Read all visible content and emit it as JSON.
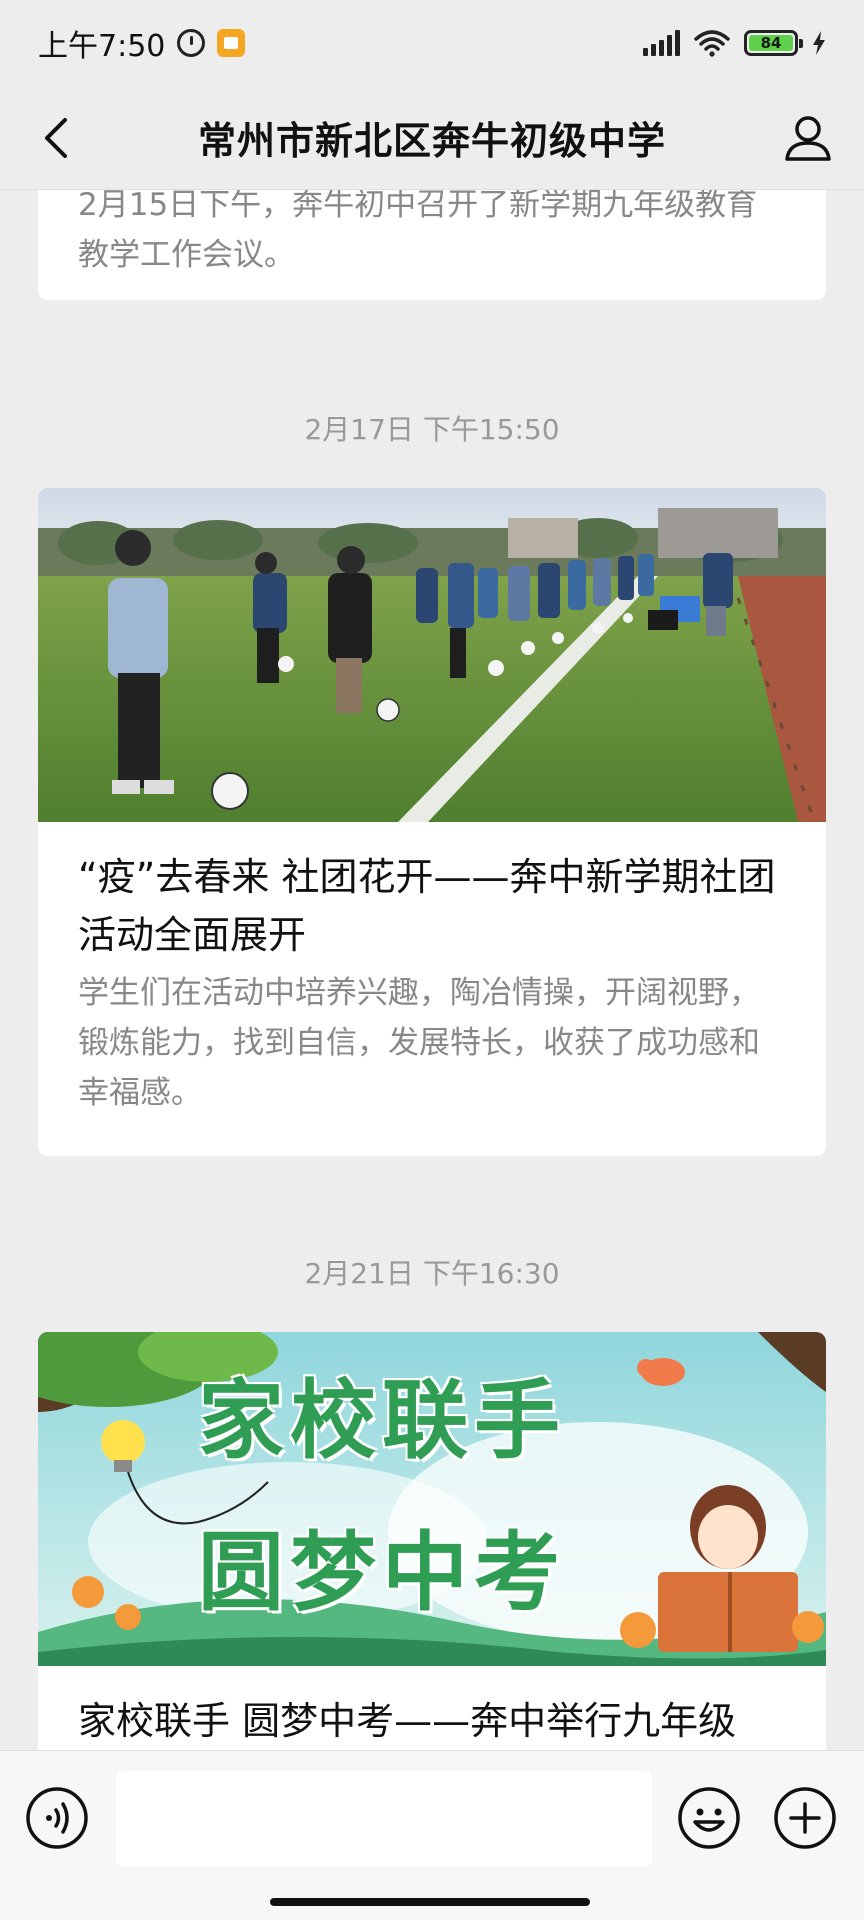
{
  "status_bar": {
    "time": "上午7:50",
    "battery_level": "84",
    "icons": [
      "alarm-icon",
      "app-badge-icon",
      "signal-icon",
      "wifi-icon",
      "battery-icon",
      "charging-bolt-icon"
    ]
  },
  "nav": {
    "title": "常州市新北区奔牛初级中学",
    "back_icon": "chevron-left-icon",
    "profile_icon": "person-icon"
  },
  "articles": [
    {
      "desc": "2月15日下午，奔牛初中召开了新学期九年级教育教学工作会议。"
    },
    {
      "timestamp": "2月17日 下午15:50",
      "title": "“疫”去春来 社团花开——奔中新学期社团活动全面展开",
      "desc": "学生们在活动中培养兴趣，陶冶情操，开阔视野，锻炼能力，找到自信，发展特长，收获了成功感和幸福感。",
      "image": "students-football-field-photo"
    },
    {
      "timestamp": "2月21日 下午16:30",
      "title": "家校联手 圆梦中考——奔中举行九年级",
      "image": "poster-illustration",
      "poster_line1": "家校联手",
      "poster_line2": "圆梦中考"
    }
  ],
  "input_bar": {
    "placeholder": "",
    "voice_icon": "voice-icon",
    "emoji_icon": "emoji-icon",
    "plus_icon": "plus-icon"
  },
  "colors": {
    "background": "#ededed",
    "card": "#ffffff",
    "muted_text": "#888888",
    "battery": "#5fd04a"
  }
}
